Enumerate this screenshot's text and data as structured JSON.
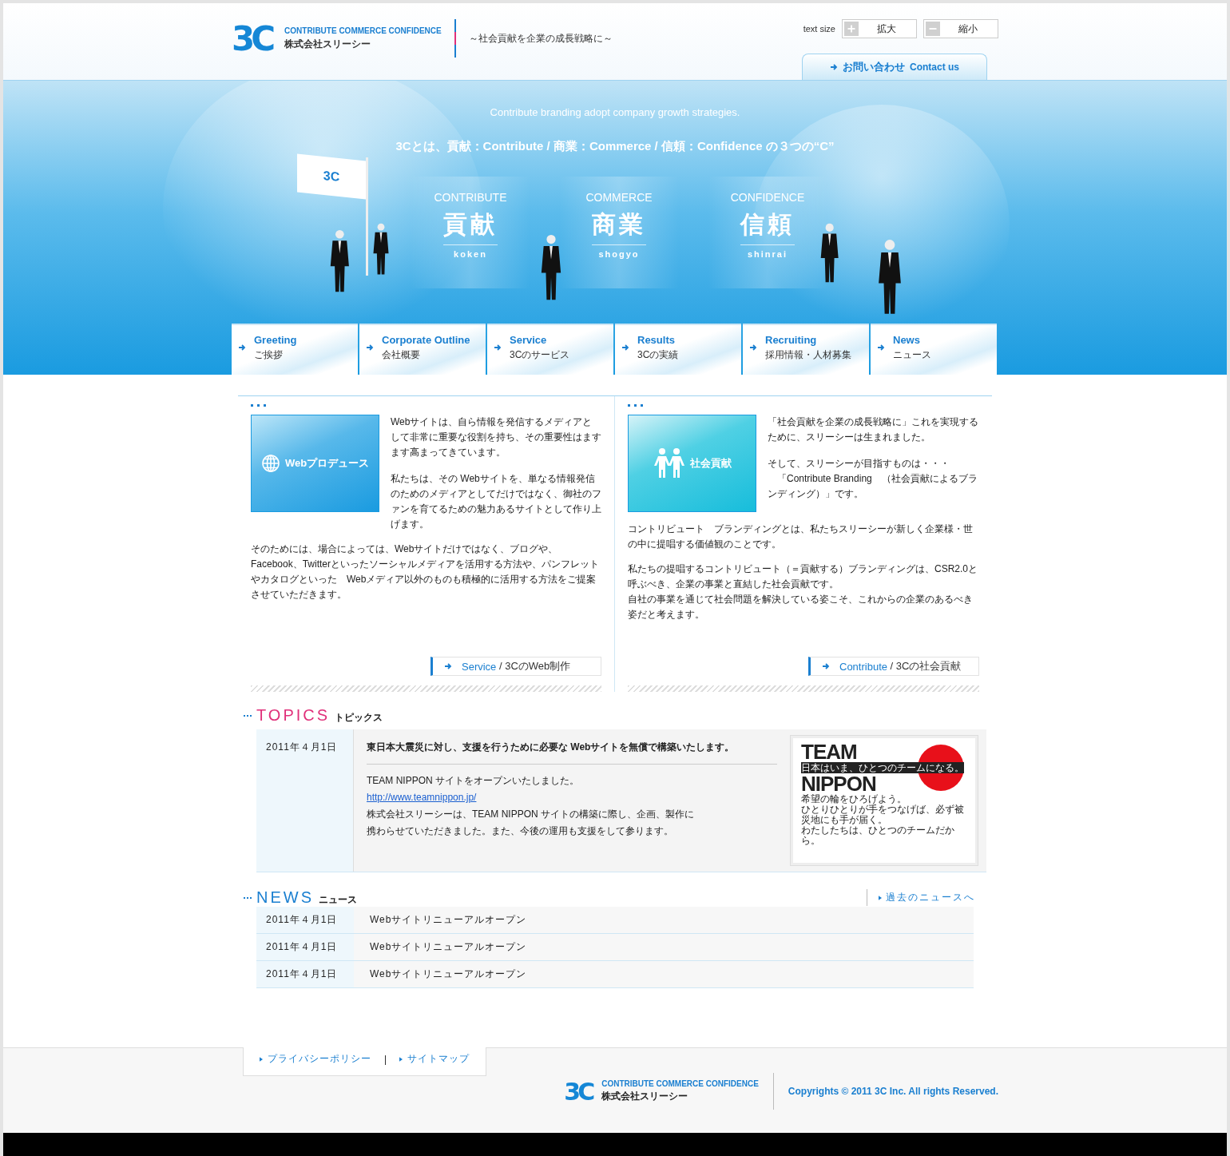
{
  "header": {
    "logo_mark": "3C",
    "logo_tagline": "CONTRIBUTE COMMERCE CONFIDENCE",
    "company": "株式会社スリーシー",
    "slogan": "～社会貢献を企業の成長戦略に～",
    "text_size_label": "text size",
    "text_size_buttons": [
      {
        "kind": "plus",
        "label": "拡大"
      },
      {
        "kind": "minus",
        "label": "縮小"
      }
    ],
    "contact": {
      "label_ja": "お問い合わせ",
      "label_en": "Contact us"
    }
  },
  "hero": {
    "tagline": "Contribute branding adopt company growth strategies.",
    "heading": "3Cとは、貢献：Contribute / 商業：Commerce / 信頼：Confidence の３つの“C”",
    "flag_text": "3C",
    "pillars": [
      {
        "en": "CONTRIBUTE",
        "kanji": "貢献",
        "romaji": "koken"
      },
      {
        "en": "COMMERCE",
        "kanji": "商業",
        "romaji": "shogyo"
      },
      {
        "en": "CONFIDENCE",
        "kanji": "信頼",
        "romaji": "shinrai"
      }
    ]
  },
  "nav": [
    {
      "en": "Greeting",
      "ja": "ご挨拶"
    },
    {
      "en": "Corporate Outline",
      "ja": "会社概要"
    },
    {
      "en": "Service",
      "ja": "3Cのサービス"
    },
    {
      "en": "Results",
      "ja": "3Cの実績"
    },
    {
      "en": "Recruiting",
      "ja": "採用情報・人材募集"
    },
    {
      "en": "News",
      "ja": "ニュース"
    }
  ],
  "intro": [
    {
      "kind": "web",
      "card_label": "Webプロデュース",
      "side_paragraphs": [
        [
          "Webサイトは、自ら情報を発信するメディアとして非常に重要な役割を持ち、その重要性はますます高まってきています。"
        ],
        [
          "私たちは、その Webサイトを、単なる情報発信のためのメディアとしてだけではなく、御社のファンを育てるための魅力あるサイトとして作り上げます。"
        ]
      ],
      "paragraphs": [
        [
          "そのためには、場合によっては、Webサイトだけではなく、ブログや、Facebook、Twitterといったソーシャルメディアを活用する方法や、パンフレットやカタログといった　Webメディア以外のものも積極的に活用する方法をご提案させていただきます。"
        ]
      ],
      "link_en": "Service",
      "link_ja": " / 3CのWeb制作"
    },
    {
      "kind": "social",
      "card_label": "社会貢献",
      "side_paragraphs": [
        [
          "「社会貢献を企業の成長戦略に」これを実現するために、スリーシーは生まれました。"
        ],
        [
          "そして、スリーシーが目指すものは・・・",
          "　「Contribute Branding　（社会貢献によるブランディング）」です。"
        ]
      ],
      "paragraphs": [
        [
          "コントリビュート　ブランディングとは、私たちスリーシーが新しく企業様・世の中に提唱する価値観のことです。"
        ],
        [
          "私たちの提唱するコントリビュート（＝貢献する）ブランディングは、CSR2.0と呼ぶべき、企業の事業と直結した社会貢献です。",
          "自社の事業を通じて社会問題を解決している姿こそ、これからの企業のあるべき姿だと考えます。"
        ]
      ],
      "link_en": "Contribute",
      "link_ja": " / 3Cの社会貢献"
    }
  ],
  "topics": {
    "title_en": "TOPICS",
    "title_ja": "トピックス",
    "date": "2011年４月1日",
    "headline": "東日本大震災に対し、支援を行うために必要な Webサイトを無償で構築いたします。",
    "lines": [
      {
        "kind": "text",
        "text": "TEAM NIPPON サイトをオープンいたしました。"
      },
      {
        "kind": "link",
        "text": "http://www.teamnippon.jp/"
      },
      {
        "kind": "text",
        "text": "株式会社スリーシーは、TEAM NIPPON サイトの構築に際し、企画、製作に"
      },
      {
        "kind": "text",
        "text": "携わらせていただきました。また、今後の運用も支援をして参ります。"
      }
    ],
    "banner": {
      "word_1": "TEAM",
      "word_2": "NIPPON",
      "strap": "日本はいま、ひとつのチームになる。",
      "message": [
        "希望の輪をひろげよう。",
        "ひとりひとりが手をつなげば、必ず被災地にも手が届く。",
        "わたしたちは、ひとつのチームだから。"
      ]
    }
  },
  "news": {
    "title_en": "NEWS",
    "title_ja": "ニュース",
    "more_link": "過去のニュースへ",
    "rows": [
      {
        "date": "2011年４月1日",
        "title": "Webサイトリニューアルオープン"
      },
      {
        "date": "2011年４月1日",
        "title": "Webサイトリニューアルオープン"
      },
      {
        "date": "2011年４月1日",
        "title": "Webサイトリニューアルオープン"
      }
    ]
  },
  "footer": {
    "links": [
      "プライバシーポリシー",
      "サイトマップ"
    ],
    "separator": "|",
    "logo_mark": "3C",
    "logo_tagline": "CONTRIBUTE COMMERCE CONFIDENCE",
    "company": "株式会社スリーシー",
    "copyright": "Copyrights © 2011 3C Inc. All rights Reserved."
  }
}
